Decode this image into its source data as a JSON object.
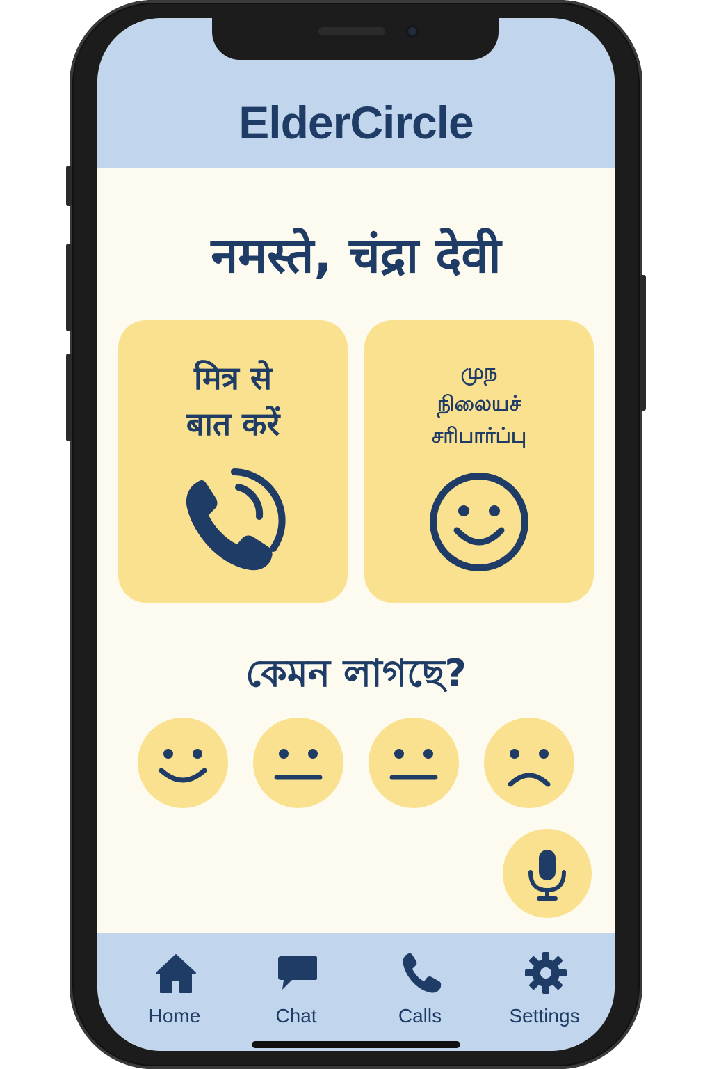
{
  "app": {
    "title": "ElderCircle"
  },
  "greeting": "नमस्ते, चंद्रा देवी",
  "cards": [
    {
      "label_lines": [
        "मित्र से",
        "बात करें"
      ],
      "icon": "phone-ringing-icon"
    },
    {
      "label_lines": [
        "முந",
        "நிலையச்",
        "சரிபார்ப்பு"
      ],
      "icon": "smiley-icon"
    }
  ],
  "mood": {
    "question": "কেমন লাগছে?",
    "options": [
      {
        "icon": "happy-face-icon"
      },
      {
        "icon": "neutral-face-icon"
      },
      {
        "icon": "neutral-face-icon"
      },
      {
        "icon": "sad-face-icon"
      }
    ]
  },
  "mic": {
    "icon": "microphone-icon"
  },
  "nav": {
    "items": [
      {
        "label": "Home",
        "icon": "home-icon"
      },
      {
        "label": "Chat",
        "icon": "chat-icon"
      },
      {
        "label": "Calls",
        "icon": "phone-icon"
      },
      {
        "label": "Settings",
        "icon": "gear-icon"
      }
    ]
  },
  "colors": {
    "header_bg": "#c1d6ec",
    "screen_bg": "#fdfbef",
    "card_bg": "#fae18f",
    "text": "#1f3c66"
  }
}
